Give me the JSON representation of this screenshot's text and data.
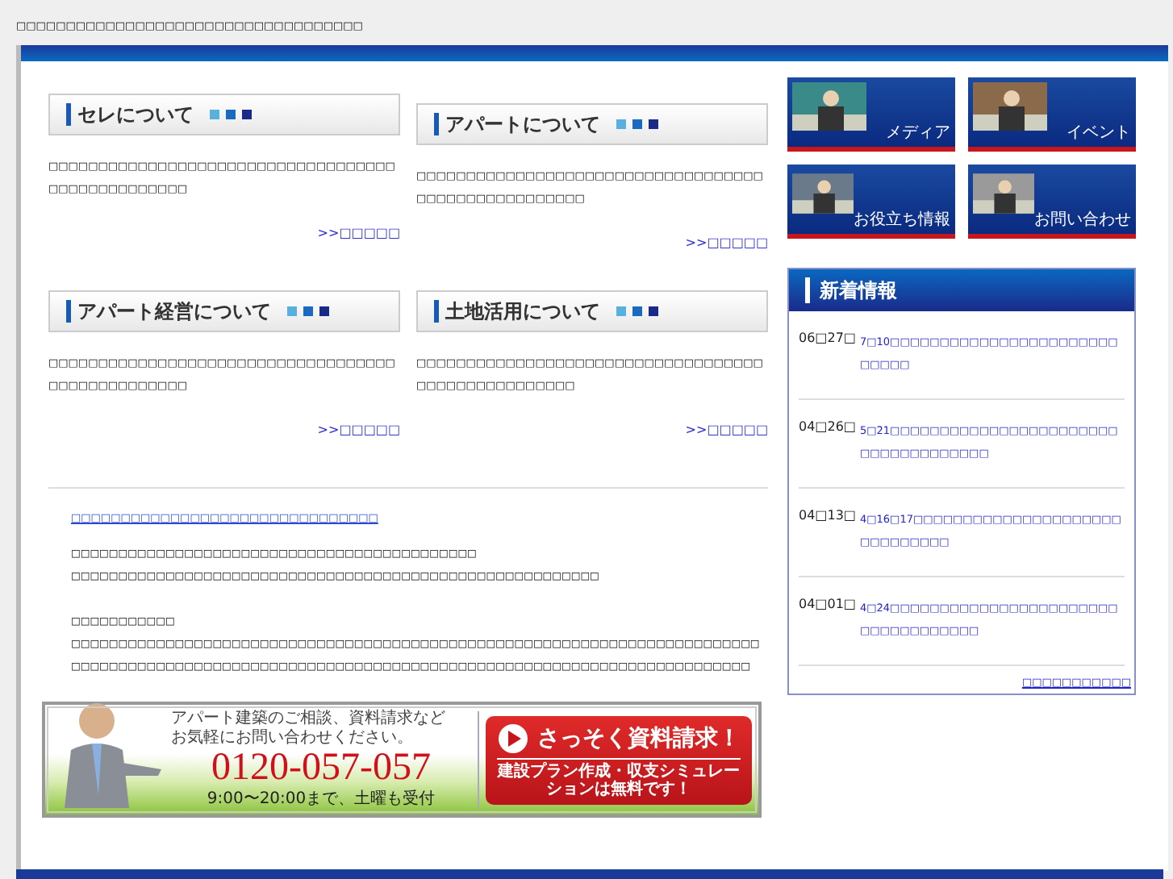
{
  "page_title": "□□□□□□□□□□□□□□□□□□□□□□□□□□□□□□□□□□□",
  "sections": [
    {
      "heading": "セレについて",
      "text": "□□□□□□□□□□□□□□□□□□□□□□□□□□□□□□□□□□□□□□□□□□□□□□□□□",
      "more": ">>□□□□□"
    },
    {
      "heading": "アパートについて",
      "text": "□□□□□□□□□□□□□□□□□□□□□□□□□□□□□□□□□□□□□□□□□□□□□□□□□□□□",
      "more": ">>□□□□□"
    },
    {
      "heading": "アパート経営について",
      "text": "□□□□□□□□□□□□□□□□□□□□□□□□□□□□□□□□□□□□□□□□□□□□□□□□□",
      "more": ">>□□□□□"
    },
    {
      "heading": "土地活用について",
      "text": "□□□□□□□□□□□□□□□□□□□□□□□□□□□□□□□□□□□□□□□□□□□□□□□□□□□",
      "more": ">>□□□□□"
    }
  ],
  "intro": {
    "link": "□□□□□□□□□□□□□□□□□□□□□□□□□□□□□□□",
    "paragraphs": [
      {
        "lines": [
          "□□□□□□□□□□□□□□□□□□□□□□□□□□□□□□□□□□□□□□□□□□□",
          "□□□□□□□□□□□□□□□□□□□□□□□□□□□□□□□□□□□□□□□□□□□□□□□□□□□□□□□□"
        ]
      },
      {
        "lines": [
          "□□□□□□□□□□□",
          "□□□□□□□□□□□□□□□□□□□□□□□□□□□□□□□□□□□□□□□□□□□□□□□□□□□□□□□□□□□□□□□□□□□□□□□□□",
          "□□□□□□□□□□□□□□□□□□□□□□□□□□□□□□□□□□□□□□□□□□□□□□□□□□□□□□□□□□□□□□□□□□□□□□□□"
        ]
      }
    ]
  },
  "banner": {
    "lead": [
      "アパート建築のご相談、資料請求など",
      "お気軽にお問い合わせください。"
    ],
    "phone": "0120-057-057",
    "hours": "9:00〜20:00まで、土曜も受付",
    "button": "さっそく資料請求！",
    "button_note": "建設プラン作成・収支シミュレーションは無料です！"
  },
  "nav_tiles": [
    {
      "label": "メディア"
    },
    {
      "label": "イベント"
    },
    {
      "label": "お役立ち情報"
    },
    {
      "label": "お問い合わせ"
    }
  ],
  "news": {
    "title": "新着情報",
    "items": [
      {
        "date": "06□27□",
        "text": "7□10□□□□□□□□□□□□□□□□□□□□□□□□□□□□"
      },
      {
        "date": "04□26□",
        "text": "5□21□□□□□□□□□□□□□□□□□□□□□□□□□□□□□□□□□□□□"
      },
      {
        "date": "04□13□",
        "text": "4□16□17□□□□□□□□□□□□□□□□□□□□□□□□□□□□□□"
      },
      {
        "date": "04□01□",
        "text": "4□24□□□□□□□□□□□□□□□□□□□□□□□□□□□□□□□□□□□"
      }
    ],
    "more": "□□□□□□□□□□□"
  }
}
